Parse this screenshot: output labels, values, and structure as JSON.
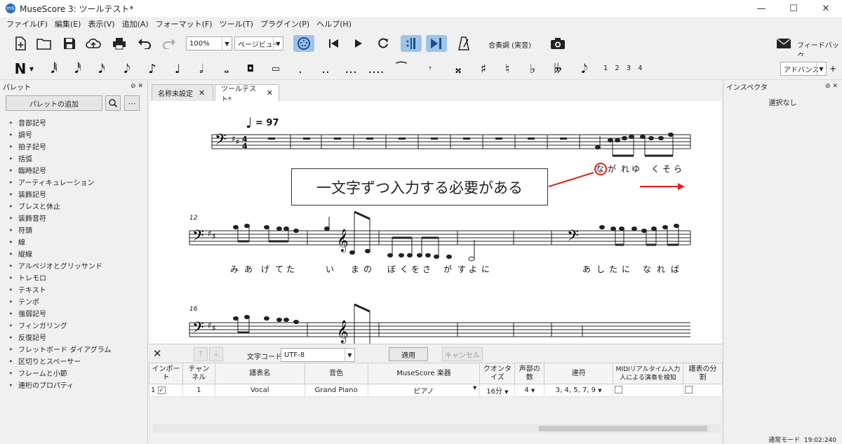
{
  "window": {
    "title": "MuseScore 3: ツールテスト*",
    "app_icon": "mS",
    "minimize": "—",
    "maximize": "☐",
    "close": "✕"
  },
  "menu": [
    "ファイル(F)",
    "編集(E)",
    "表示(V)",
    "追加(A)",
    "フォーマット(F)",
    "ツール(T)",
    "プラグイン(P)",
    "ヘルプ(H)"
  ],
  "toolbar": {
    "zoom": "100%",
    "view_mode": "ページビュー",
    "concert_pitch": "合奏調 (実音)",
    "feedback": "フィードバック"
  },
  "notetoolbar": {
    "voices": [
      "1",
      "2",
      "3",
      "4"
    ],
    "workspace": "アドバンス"
  },
  "palette": {
    "title": "パレット",
    "add_button": "パレットの追加",
    "items": [
      "音部記号",
      "調号",
      "拍子記号",
      "括弧",
      "臨時記号",
      "アーティキュレーション",
      "装飾記号",
      "ブレスと休止",
      "装飾音符",
      "符頭",
      "線",
      "縦線",
      "アルペジオとグリッサンド",
      "トレモロ",
      "テキスト",
      "テンポ",
      "強弱記号",
      "フィンガリング",
      "反復記号",
      "フレットボード ダイアグラム",
      "区切りとスペーサー",
      "フレームと小節",
      "連桁のプロパティ"
    ]
  },
  "tabs": [
    {
      "label": "名称未設定",
      "active": false
    },
    {
      "label": "ツールテスト*",
      "active": true
    }
  ],
  "score": {
    "tempo": "= 97",
    "measure_12": "12",
    "measure_16": "16",
    "lyrics_line1": [
      "な",
      "が",
      "れ",
      "ゆ",
      "く",
      "そ",
      "ら"
    ],
    "lyrics_line2a": [
      "み",
      "あ",
      "げ",
      "て",
      "た",
      "い",
      "ま",
      "の",
      "ぼ",
      "く",
      "を",
      "さ",
      "が",
      "す",
      "よ",
      "に"
    ],
    "lyrics_line2b": [
      "あ",
      "し",
      "た",
      "に",
      "な",
      "れ",
      "ば"
    ]
  },
  "annotation": {
    "callout": "一文字ずつ入力する必要がある",
    "color": "#e0201a"
  },
  "inspector": {
    "title": "インスペクタ",
    "empty": "選択なし"
  },
  "import": {
    "close": "✕",
    "charset_label": "文字コード:",
    "charset": "UTF-8",
    "apply": "適用",
    "cancel": "キャンセル",
    "columns": [
      "インポート",
      "チャンネル",
      "譜表名",
      "音色",
      "MuseScore 楽器",
      "クオンタイズ",
      "声部の数",
      "連符",
      "MIDIリアルタイム入力人による演奏を検知",
      "譜表の分割"
    ],
    "row": {
      "index": "1",
      "import": true,
      "channel": "1",
      "staff": "Vocal",
      "sound": "Grand Piano",
      "instrument": "ピアノ",
      "quantize": "16分",
      "voices": "4",
      "tuplets": "3, 4, 5, 7, 9"
    }
  },
  "status": {
    "mode": "通常モード",
    "time": "19:02:240"
  }
}
